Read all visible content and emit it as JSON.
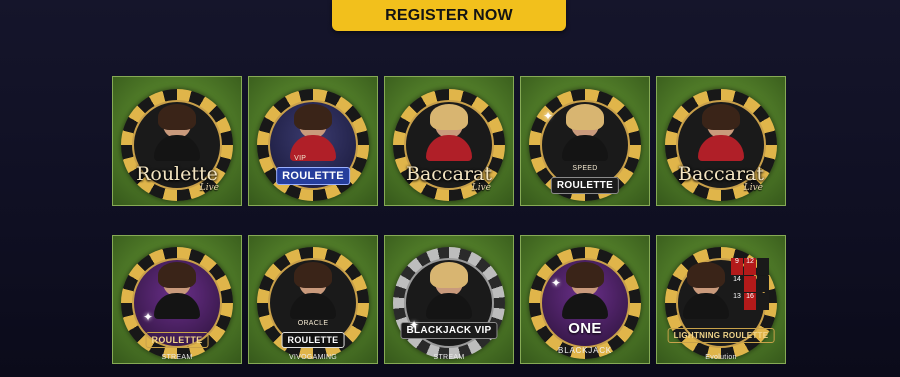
{
  "header": {
    "register_label": "REGISTER NOW"
  },
  "games_row1": [
    {
      "title": "Roulette",
      "subtitle": "Live"
    },
    {
      "title": "ROULETTE",
      "tag": "VIP"
    },
    {
      "title": "Baccarat",
      "subtitle": "Live"
    },
    {
      "title": "ROULETTE",
      "tag": "SPEED"
    },
    {
      "title": "Baccarat",
      "subtitle": "Live"
    }
  ],
  "games_row2": [
    {
      "title": "ROULETTE",
      "provider": "STREAM"
    },
    {
      "title": "ROULETTE",
      "label_top": "ORACLE",
      "provider": "VIVOGAMING"
    },
    {
      "title": "BLACKJACK VIP",
      "provider": "STREAM"
    },
    {
      "title": "ONE",
      "subtitle": "BLACKJACK"
    },
    {
      "title": "LIGHTNING ROULETTE",
      "provider": "Evolution",
      "board": [
        "9",
        "12",
        "",
        "14",
        "",
        "",
        "13",
        "16",
        ""
      ]
    }
  ],
  "colors": {
    "accent": "#f2c01c",
    "tile_green": "#4f7a28",
    "tile_border": "#86aa55",
    "background": "#12122a"
  },
  "icons": {
    "sparkle": "✦"
  }
}
